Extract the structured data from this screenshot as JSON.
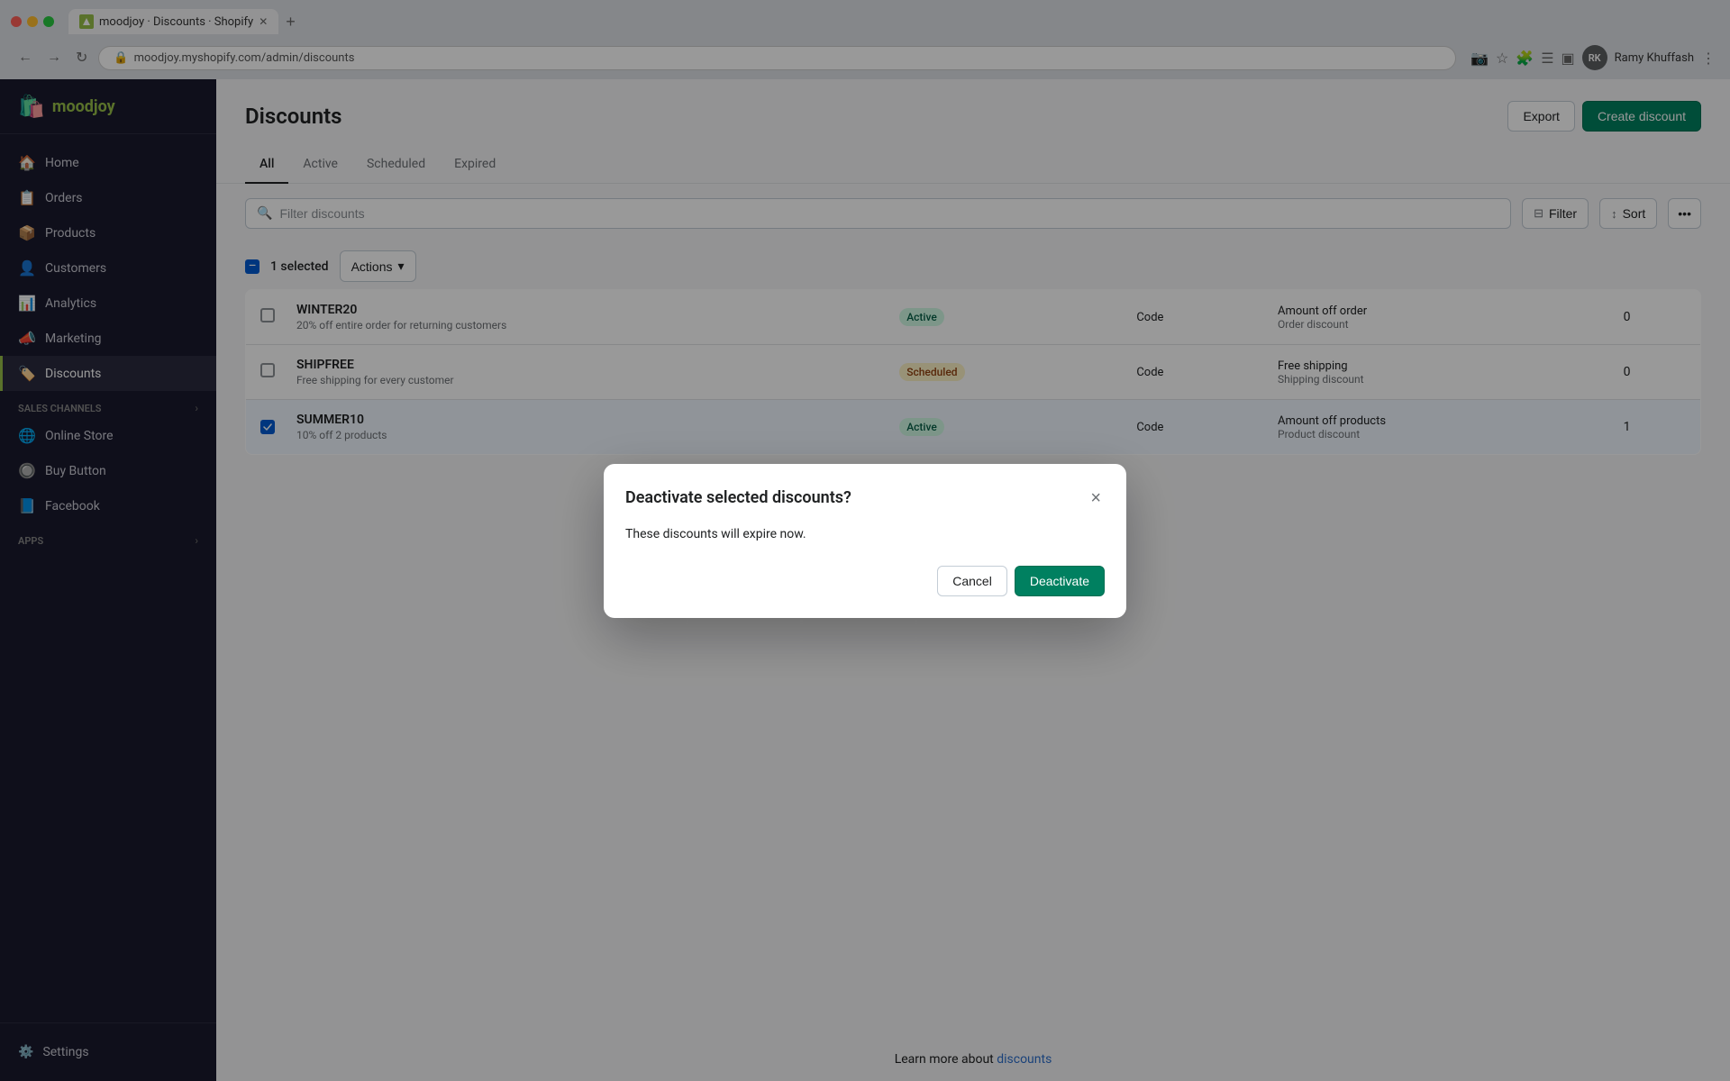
{
  "browser": {
    "tab_title": "moodjoy · Discounts · Shopify",
    "url_prefix": "moodjoy.myshopify.com",
    "url_path": "/admin/discounts",
    "url_display": "moodjoy.myshopify.com/admin/discounts",
    "user_initials": "RK",
    "user_name": "Ramy Khuffash"
  },
  "sidebar": {
    "store_name": "moodjoy",
    "nav_items": [
      {
        "id": "home",
        "label": "Home",
        "icon": "🏠"
      },
      {
        "id": "orders",
        "label": "Orders",
        "icon": "📋"
      },
      {
        "id": "products",
        "label": "Products",
        "icon": "📦"
      },
      {
        "id": "customers",
        "label": "Customers",
        "icon": "👤"
      },
      {
        "id": "analytics",
        "label": "Analytics",
        "icon": "📊"
      },
      {
        "id": "marketing",
        "label": "Marketing",
        "icon": "📣"
      },
      {
        "id": "discounts",
        "label": "Discounts",
        "icon": "🏷️",
        "active": true
      }
    ],
    "sales_channels_label": "Sales channels",
    "sales_channels": [
      {
        "id": "online-store",
        "label": "Online Store",
        "icon": "🌐"
      },
      {
        "id": "buy-button",
        "label": "Buy Button",
        "icon": "🔘"
      },
      {
        "id": "facebook",
        "label": "Facebook",
        "icon": "📘"
      }
    ],
    "apps_label": "Apps",
    "settings_label": "Settings"
  },
  "page": {
    "title": "Discounts",
    "export_btn": "Export",
    "create_btn": "Create discount",
    "tabs": [
      {
        "id": "all",
        "label": "All",
        "active": true
      },
      {
        "id": "active",
        "label": "Active"
      },
      {
        "id": "scheduled",
        "label": "Scheduled"
      },
      {
        "id": "expired",
        "label": "Expired"
      }
    ],
    "search_placeholder": "Filter discounts",
    "filter_btn": "Filter",
    "sort_btn": "Sort",
    "selected_count": "1 selected",
    "actions_btn": "Actions",
    "footer_text": "Learn more about ",
    "footer_link_text": "discounts",
    "table": {
      "rows": [
        {
          "id": "winter20",
          "code": "WINTER20",
          "description": "20% off entire order for returning customers",
          "status": "Active",
          "status_type": "active",
          "method": "Code",
          "type_label": "Amount off order",
          "type_sub": "Order discount",
          "uses": "0",
          "checked": false
        },
        {
          "id": "shipfree",
          "code": "SHIPFREE",
          "description": "Free shipping for every customer",
          "status": "Scheduled",
          "status_type": "scheduled",
          "method": "Code",
          "type_label": "Free shipping",
          "type_sub": "Shipping discount",
          "uses": "0",
          "checked": false
        },
        {
          "id": "summer10",
          "code": "SUMMER10",
          "description": "10% off 2 products",
          "status": "Active",
          "status_type": "active",
          "method": "Code",
          "type_label": "Amount off products",
          "type_sub": "Product discount",
          "uses": "1",
          "checked": true
        }
      ]
    }
  },
  "modal": {
    "title": "Deactivate selected discounts?",
    "body_text": "These discounts will expire now.",
    "cancel_btn": "Cancel",
    "deactivate_btn": "Deactivate",
    "close_icon": "×"
  }
}
